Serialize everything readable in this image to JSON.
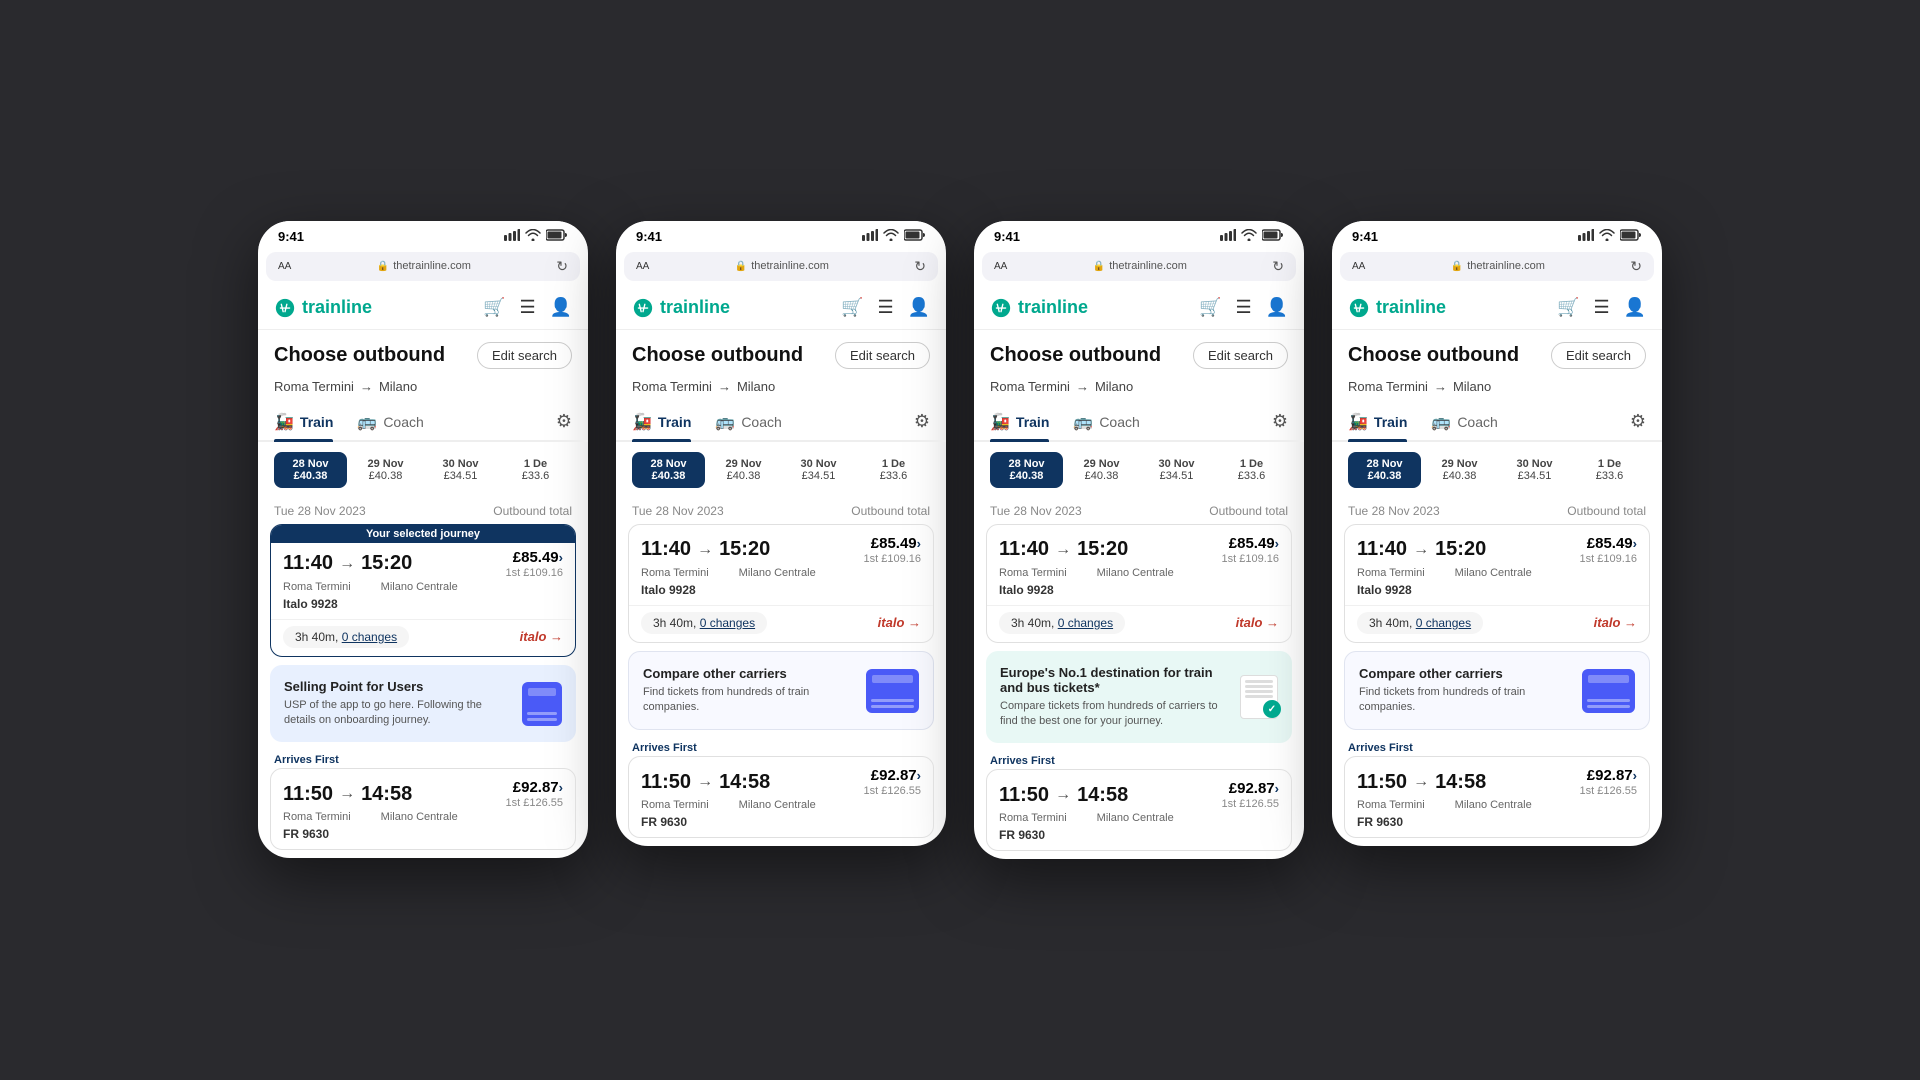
{
  "phones": [
    {
      "id": "phone1",
      "statusBar": {
        "time": "9:41",
        "url": "thetrainline.com"
      },
      "header": {
        "title": "Choose outbound",
        "editSearch": "Edit search"
      },
      "route": "Roma Termini → Milano",
      "tabs": {
        "train": "Train",
        "coach": "Coach"
      },
      "dates": [
        {
          "label": "28 Nov",
          "price": "£40.38",
          "active": true
        },
        {
          "label": "29 Nov",
          "price": "£40.38",
          "active": false
        },
        {
          "label": "30 Nov",
          "price": "£34.51",
          "active": false
        },
        {
          "label": "1 De",
          "price": "£33.6",
          "active": false
        }
      ],
      "sectionDate": "Tue 28 Nov 2023",
      "outboundTotal": "Outbound total",
      "journeys": [
        {
          "selected": true,
          "selectedLabel": "Your selected journey",
          "depTime": "11:40",
          "arrTime": "15:20",
          "price": "£85.49",
          "firstClass": "1st £109.16",
          "fromStation": "Roma Termini",
          "toStation": "Milano Centrale",
          "trainRef": "Italo 9928",
          "duration": "3h 40m",
          "changes": "0 changes",
          "operator": "italo"
        }
      ],
      "banner": {
        "type": "usp",
        "title": "Selling Point for Users",
        "text": "USP of the app to go here. Following the details on onboarding journey.",
        "illustrationType": "card"
      },
      "arrivesFirst": {
        "label": "Arrives First",
        "journey2": {
          "depTime": "11:50",
          "arrTime": "14:58",
          "price": "£92.87",
          "firstClass": "1st £126.55",
          "fromStation": "Roma Termini",
          "toStation": "Milano Centrale",
          "trainRef": "FR 9630"
        }
      }
    },
    {
      "id": "phone2",
      "statusBar": {
        "time": "9:41",
        "url": "thetrainline.com"
      },
      "header": {
        "title": "Choose outbound",
        "editSearch": "Edit search"
      },
      "route": "Roma Termini → Milano",
      "tabs": {
        "train": "Train",
        "coach": "Coach"
      },
      "dates": [
        {
          "label": "28 Nov",
          "price": "£40.38",
          "active": true
        },
        {
          "label": "29 Nov",
          "price": "£40.38",
          "active": false
        },
        {
          "label": "30 Nov",
          "price": "£34.51",
          "active": false
        },
        {
          "label": "1 De",
          "price": "£33.6",
          "active": false
        }
      ],
      "sectionDate": "Tue 28 Nov 2023",
      "outboundTotal": "Outbound total",
      "journeys": [
        {
          "selected": false,
          "depTime": "11:40",
          "arrTime": "15:20",
          "price": "£85.49",
          "firstClass": "1st £109.16",
          "fromStation": "Roma Termini",
          "toStation": "Milano Centrale",
          "trainRef": "Italo 9928",
          "duration": "3h 40m",
          "changes": "0 changes",
          "operator": "italo"
        }
      ],
      "banner": {
        "type": "compare",
        "title": "Compare other carriers",
        "text": "Find tickets from hundreds of train companies.",
        "illustrationType": "card"
      },
      "arrivesFirst": {
        "label": "Arrives First",
        "journey2": {
          "depTime": "11:50",
          "arrTime": "14:58",
          "price": "£92.87",
          "firstClass": "1st £126.55",
          "fromStation": "Roma Termini",
          "toStation": "Milano Centrale",
          "trainRef": "FR 9630"
        }
      }
    },
    {
      "id": "phone3",
      "statusBar": {
        "time": "9:41",
        "url": "thetrainline.com"
      },
      "header": {
        "title": "Choose outbound",
        "editSearch": "Edit search"
      },
      "route": "Roma Termini → Milano",
      "tabs": {
        "train": "Train",
        "coach": "Coach"
      },
      "dates": [
        {
          "label": "28 Nov",
          "price": "£40.38",
          "active": true
        },
        {
          "label": "29 Nov",
          "price": "£40.38",
          "active": false
        },
        {
          "label": "30 Nov",
          "price": "£34.51",
          "active": false
        },
        {
          "label": "1 De",
          "price": "£33.6",
          "active": false
        }
      ],
      "sectionDate": "Tue 28 Nov 2023",
      "outboundTotal": "Outbound total",
      "journeys": [
        {
          "selected": false,
          "depTime": "11:40",
          "arrTime": "15:20",
          "price": "£85.49",
          "firstClass": "1st £109.16",
          "fromStation": "Roma Termini",
          "toStation": "Milano Centrale",
          "trainRef": "Italo 9928",
          "duration": "3h 40m",
          "changes": "0 changes",
          "operator": "italo"
        }
      ],
      "banner": {
        "type": "europe",
        "title": "Europe's No.1 destination for train and bus tickets*",
        "text": "Compare tickets from hundreds of carriers to find the best one for your journey.",
        "illustrationType": "cert"
      },
      "arrivesFirst": {
        "label": "Arrives First",
        "journey2": {
          "depTime": "11:50",
          "arrTime": "14:58",
          "price": "£92.87",
          "firstClass": "1st £126.55",
          "fromStation": "Roma Termini",
          "toStation": "Milano Centrale",
          "trainRef": "FR 9630"
        }
      }
    },
    {
      "id": "phone4",
      "statusBar": {
        "time": "9:41",
        "url": "thetrainline.com"
      },
      "header": {
        "title": "Choose outbound",
        "editSearch": "Edit search"
      },
      "route": "Roma Termini → Milano",
      "tabs": {
        "train": "Train",
        "coach": "Coach"
      },
      "dates": [
        {
          "label": "28 Nov",
          "price": "£40.38",
          "active": true
        },
        {
          "label": "29 Nov",
          "price": "£40.38",
          "active": false
        },
        {
          "label": "30 Nov",
          "price": "£34.51",
          "active": false
        },
        {
          "label": "1 De",
          "price": "£33.6",
          "active": false
        }
      ],
      "sectionDate": "Tue 28 Nov 2023",
      "outboundTotal": "Outbound total",
      "journeys": [
        {
          "selected": false,
          "depTime": "11:40",
          "arrTime": "15:20",
          "price": "£85.49",
          "firstClass": "1st £109.16",
          "fromStation": "Roma Termini",
          "toStation": "Milano Centrale",
          "trainRef": "Italo 9928",
          "duration": "3h 40m",
          "changes": "0 changes",
          "operator": "italo"
        }
      ],
      "banner": {
        "type": "compare",
        "title": "Compare other carriers",
        "text": "Find tickets from hundreds of train companies.",
        "illustrationType": "card"
      },
      "arrivesFirst": {
        "label": "Arrives First",
        "journey2": {
          "depTime": "11:50",
          "arrTime": "14:58",
          "price": "£92.87",
          "firstClass": "1st £126.55",
          "fromStation": "Roma Termini",
          "toStation": "Milano Centrale",
          "trainRef": "FR 9630"
        }
      }
    }
  ]
}
